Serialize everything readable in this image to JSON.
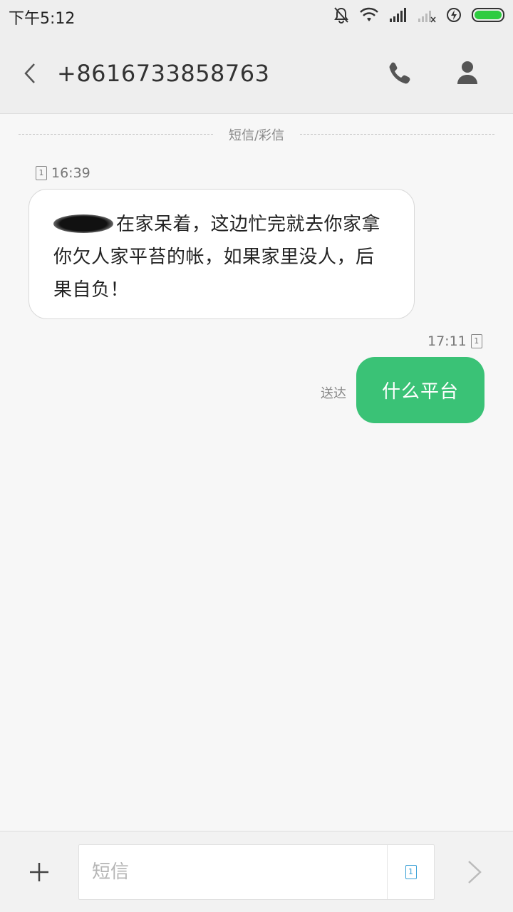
{
  "status_bar": {
    "time": "下午5:12",
    "icons": [
      "bell-off-icon",
      "wifi-icon",
      "signal-icon",
      "signal-none-icon",
      "charging-icon",
      "battery-icon"
    ],
    "battery_color": "#2ecc40"
  },
  "header": {
    "title": "+8616733858763",
    "back_icon": "chevron-left-icon",
    "call_icon": "phone-icon",
    "contact_icon": "person-icon"
  },
  "thread": {
    "channel_label": "短信/彩信",
    "messages": [
      {
        "direction": "incoming",
        "sim": "1",
        "time": "16:39",
        "text": "在家呆着，这边忙完就去你家拿你欠人家平苔的帐，如果家里没人，后果自负！",
        "redacted_prefix": true
      },
      {
        "direction": "outgoing",
        "sim": "1",
        "time": "17:11",
        "status": "送达",
        "text": "什么平台"
      }
    ]
  },
  "composer": {
    "add_icon": "plus-icon",
    "placeholder": "短信",
    "sim": "1",
    "send_icon": "chevron-right-icon"
  },
  "colors": {
    "outgoing_bubble": "#3ac276",
    "incoming_bubble": "#ffffff",
    "background": "#f7f7f7",
    "header": "#eeeeee"
  }
}
